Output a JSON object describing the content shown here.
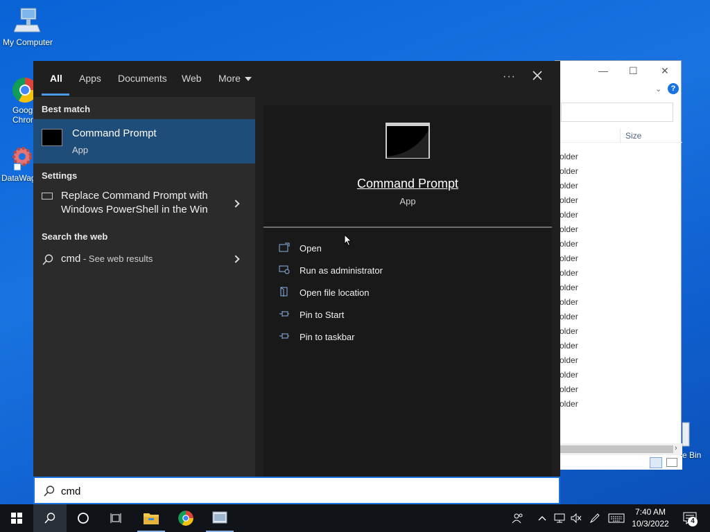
{
  "desktop": {
    "icons": [
      {
        "label": "My Computer"
      },
      {
        "label_line1": "Goog",
        "label_line2": "Chron"
      },
      {
        "label": "DataWag"
      },
      {
        "label": "e Bin"
      }
    ]
  },
  "explorer": {
    "column_size": "Size",
    "rows": [
      "older",
      "older",
      "older",
      "older",
      "older",
      "older",
      "older",
      "older",
      "older",
      "older",
      "older",
      "older",
      "older",
      "older",
      "older",
      "older",
      "older",
      "older"
    ]
  },
  "search": {
    "tabs": [
      {
        "label": "All"
      },
      {
        "label": "Apps"
      },
      {
        "label": "Documents"
      },
      {
        "label": "Web"
      },
      {
        "label": "More"
      }
    ],
    "more_options": "···",
    "sections": {
      "best_match": "Best match",
      "settings": "Settings",
      "search_web": "Search the web"
    },
    "best_match": {
      "name": "Command Prompt",
      "type": "App"
    },
    "setting_item": {
      "line1": "Replace Command Prompt with",
      "line2": "Windows PowerShell in the Win"
    },
    "web_item": {
      "query": "cmd",
      "hint": " - See web results"
    },
    "preview": {
      "title": "Command Prompt",
      "type": "App"
    },
    "actions": [
      {
        "label": "Open"
      },
      {
        "label": "Run as administrator"
      },
      {
        "label": "Open file location"
      },
      {
        "label": "Pin to Start"
      },
      {
        "label": "Pin to taskbar"
      }
    ],
    "query": "cmd"
  },
  "taskbar": {
    "time": "7:40 AM",
    "date": "10/3/2022",
    "notification_count": "4"
  },
  "colors": {
    "accent": "#1a73e0",
    "selection": "#1e4d7a",
    "panel_dark": "#1f1f1f",
    "taskbar": "#101418"
  }
}
